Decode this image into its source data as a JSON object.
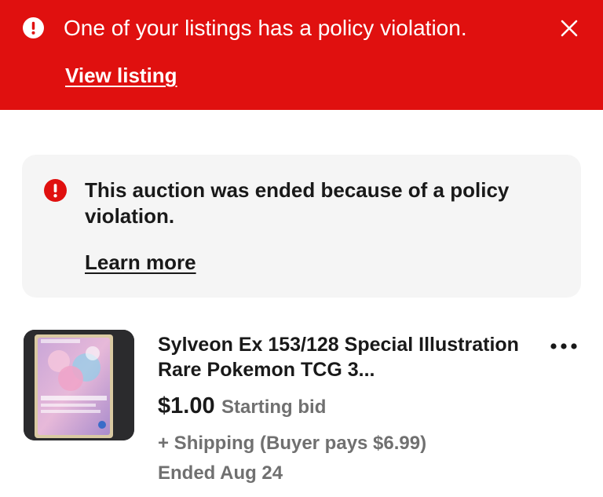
{
  "banner": {
    "message": "One of your listings has a policy violation.",
    "link": "View listing",
    "alert_icon": "alert-circle-icon",
    "close_icon": "close-icon",
    "background": "#e0100f"
  },
  "status_card": {
    "message": "This auction was ended because of a policy violation.",
    "link": "Learn more",
    "icon": "error-circle-icon",
    "icon_color": "#e0100f"
  },
  "listing": {
    "title": "Sylveon Ex 153/128 Special Illustration Rare Pokemon TCG 3...",
    "price": "$1.00",
    "price_note": "Starting bid",
    "shipping": "+ Shipping (Buyer pays $6.99)",
    "status": "Ended Aug 24",
    "more_icon": "more-horizontal-icon"
  }
}
